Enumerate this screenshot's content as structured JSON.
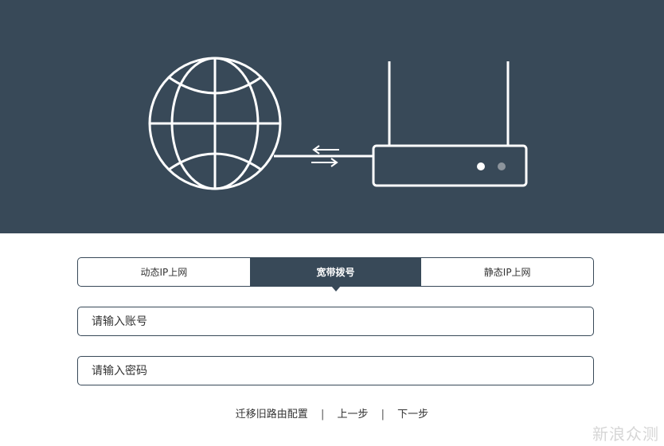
{
  "tabs": [
    {
      "label": "动态IP上网",
      "active": false
    },
    {
      "label": "宽带拨号",
      "active": true
    },
    {
      "label": "静态IP上网",
      "active": false
    }
  ],
  "form": {
    "account_placeholder": "请输入账号",
    "password_placeholder": "请输入密码"
  },
  "footer": {
    "migrate_label": "迁移旧路由配置",
    "prev_label": "上一步",
    "next_label": "下一步",
    "separator": "|"
  },
  "watermark": "新浪众测",
  "colors": {
    "hero_bg": "#384958",
    "accent": "#384958",
    "illustration": "#ffffff"
  },
  "icons": [
    "globe-icon",
    "transfer-arrows-icon",
    "router-icon"
  ]
}
